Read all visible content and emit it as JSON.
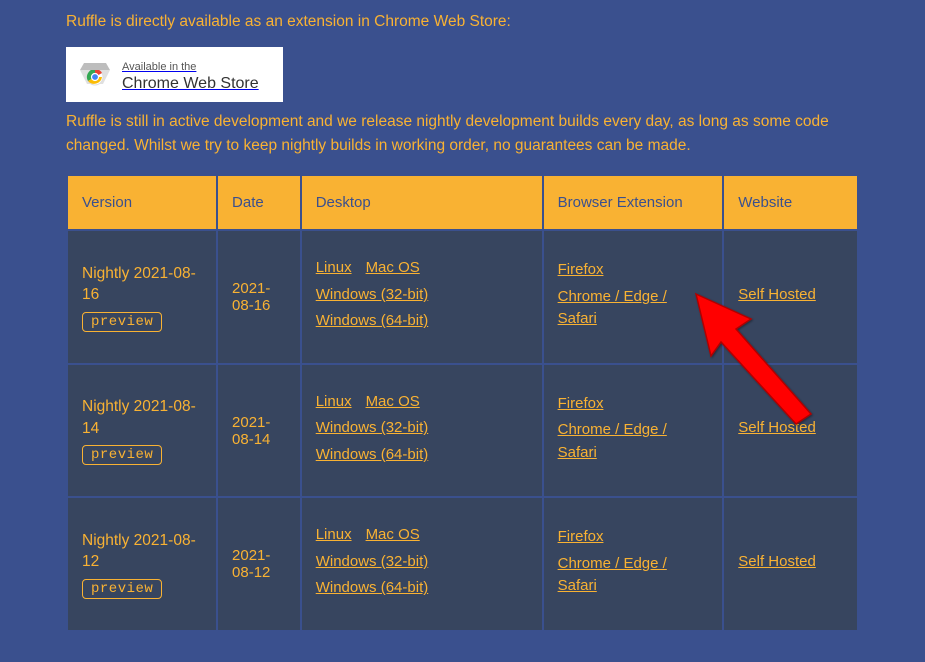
{
  "intro_text": "Ruffle is directly available as an extension in Chrome Web Store:",
  "chrome_badge": {
    "line1": "Available in the",
    "line2": "Chrome Web Store"
  },
  "release_text": "Ruffle is still in active development and we release nightly development builds every day, as long as some code changed. Whilst we try to keep nightly builds in working order, no guarantees can be made.",
  "headers": {
    "version": "Version",
    "date": "Date",
    "desktop": "Desktop",
    "ext": "Browser Extension",
    "website": "Website"
  },
  "preview_label": "preview",
  "links": {
    "linux": "Linux",
    "macos": "Mac OS",
    "win32": "Windows (32-bit)",
    "win64": "Windows (64-bit)",
    "firefox": "Firefox",
    "chrome_edge_safari": "Chrome / Edge / Safari",
    "self_hosted": "Self Hosted"
  },
  "rows": [
    {
      "version": "Nightly 2021-08-16",
      "date": "2021-08-16"
    },
    {
      "version": "Nightly 2021-08-14",
      "date": "2021-08-14"
    },
    {
      "version": "Nightly 2021-08-12",
      "date": "2021-08-12"
    }
  ],
  "arrow": {
    "color": "#ff0000"
  }
}
